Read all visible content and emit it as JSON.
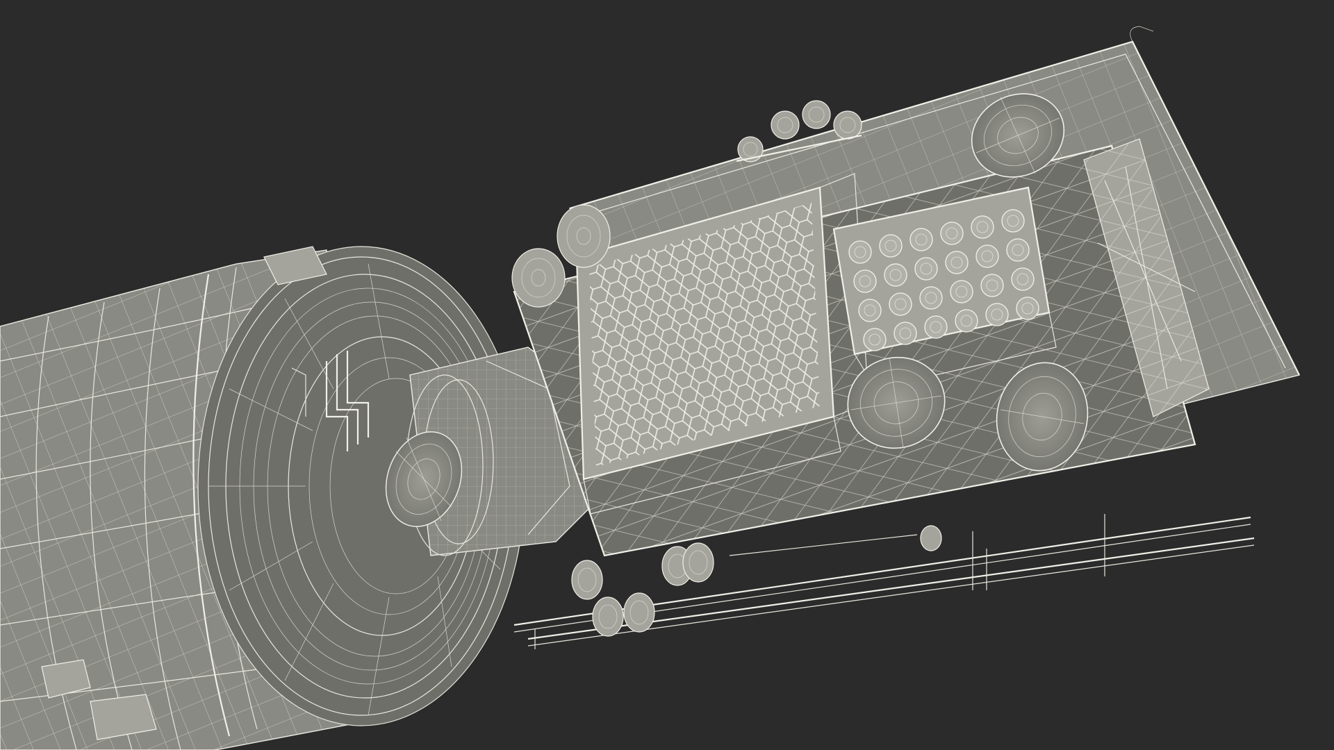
{
  "scene": {
    "background_color": "#2b2b2b",
    "wire_color": "#e9e8df",
    "surface_color": "#8a8a84",
    "subject": "satellite-wireframe-model"
  }
}
